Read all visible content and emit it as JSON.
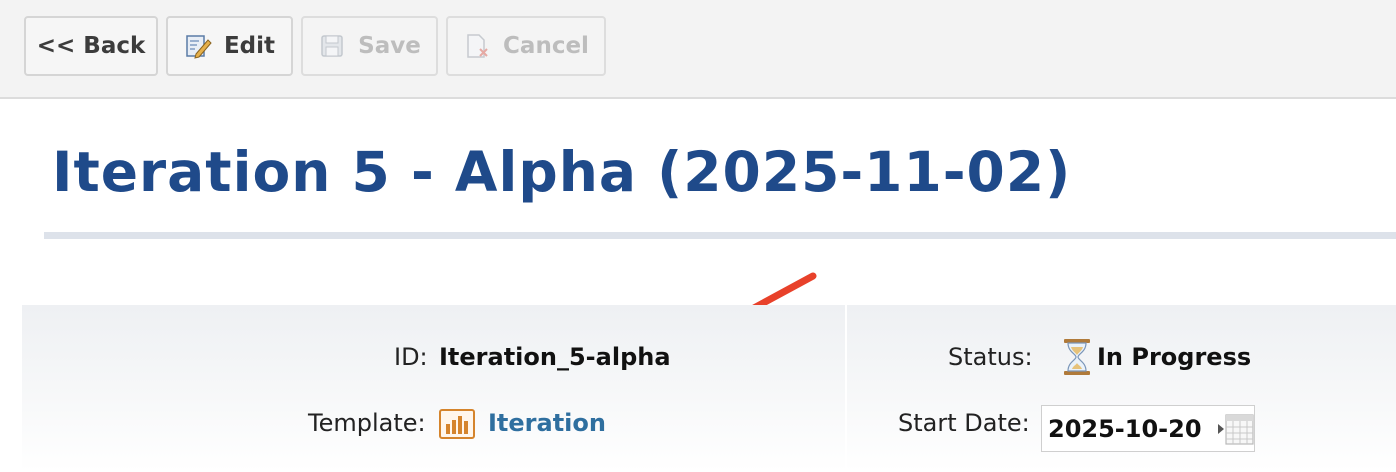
{
  "toolbar": {
    "back_label": "<< Back",
    "edit_label": "Edit",
    "save_label": "Save",
    "cancel_label": "Cancel"
  },
  "page": {
    "title": "Iteration 5 - Alpha",
    "title_date": "(2025-11-02)"
  },
  "details": {
    "id_label": "ID:",
    "id_value": "Iteration_5-alpha",
    "template_label": "Template:",
    "template_value": "Iteration",
    "status_label": "Status:",
    "status_value": "In Progress",
    "start_date_label": "Start Date:",
    "start_date_value": "2025-10-20"
  },
  "icons": {
    "edit": "pencil-document-icon",
    "save": "floppy-disk-icon",
    "cancel": "document-x-icon",
    "template": "bar-chart-icon",
    "status": "hourglass-icon",
    "calendar": "calendar-icon"
  },
  "colors": {
    "title": "#1f4a8a",
    "link": "#2f6f9f",
    "annotation_arrow": "#e8412a"
  }
}
